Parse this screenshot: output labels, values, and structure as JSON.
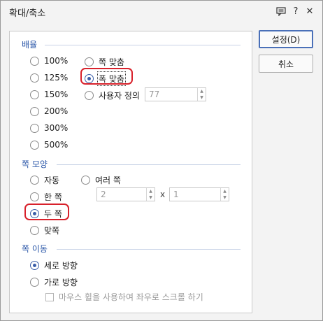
{
  "window": {
    "title": "확대/축소",
    "help_symbol": "?",
    "close_symbol": "✕"
  },
  "buttons": {
    "ok_label": "설정(D)",
    "cancel_label": "취소"
  },
  "zoom": {
    "label": "배율",
    "options": [
      "100%",
      "125%",
      "150%",
      "200%",
      "300%",
      "500%"
    ],
    "fit_page_label": "쪽 맞춤",
    "fit_width_label": "폭 맞춤",
    "custom_label": "사용자 정의",
    "custom_value": "77",
    "selected": "폭 맞춤"
  },
  "page_shape": {
    "label": "쪽 모양",
    "auto_label": "자동",
    "multi_label": "여러 쪽",
    "single_label": "한 쪽",
    "two_label": "두 쪽",
    "spread_label": "맞쪽",
    "rows_value": "2",
    "cols_value": "1",
    "times_symbol": "x",
    "selected": "두 쪽"
  },
  "page_move": {
    "label": "쪽 이동",
    "vertical_label": "세로 방향",
    "horizontal_label": "가로 방향",
    "wheel_label": "마우스 휠을 사용하여 좌우로 스크롤 하기",
    "selected": "세로 방향",
    "wheel_checked": false
  },
  "colors": {
    "accent": "#2a56a8",
    "highlight": "#d8212b"
  }
}
